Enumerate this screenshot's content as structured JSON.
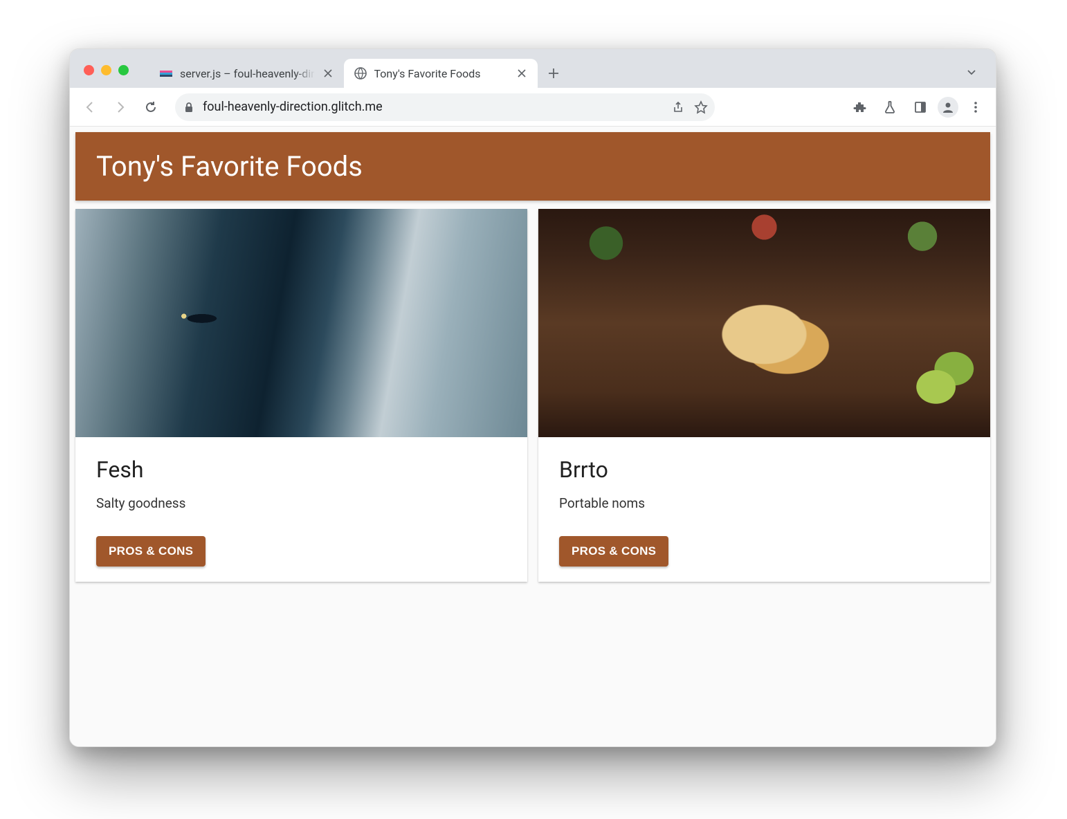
{
  "browser": {
    "tabs": [
      {
        "title": "server.js – foul-heavenly-dir",
        "active": false
      },
      {
        "title": "Tony's Favorite Foods",
        "active": true
      }
    ],
    "url": "foul-heavenly-direction.glitch.me"
  },
  "page": {
    "header_title": "Tony's Favorite Foods",
    "cards": [
      {
        "title": "Fesh",
        "description": "Salty goodness",
        "button_label": "PROS & CONS",
        "image": "fish"
      },
      {
        "title": "Brrto",
        "description": "Portable noms",
        "button_label": "PROS & CONS",
        "image": "burrito"
      }
    ]
  },
  "colors": {
    "brand": "#a0572b"
  }
}
